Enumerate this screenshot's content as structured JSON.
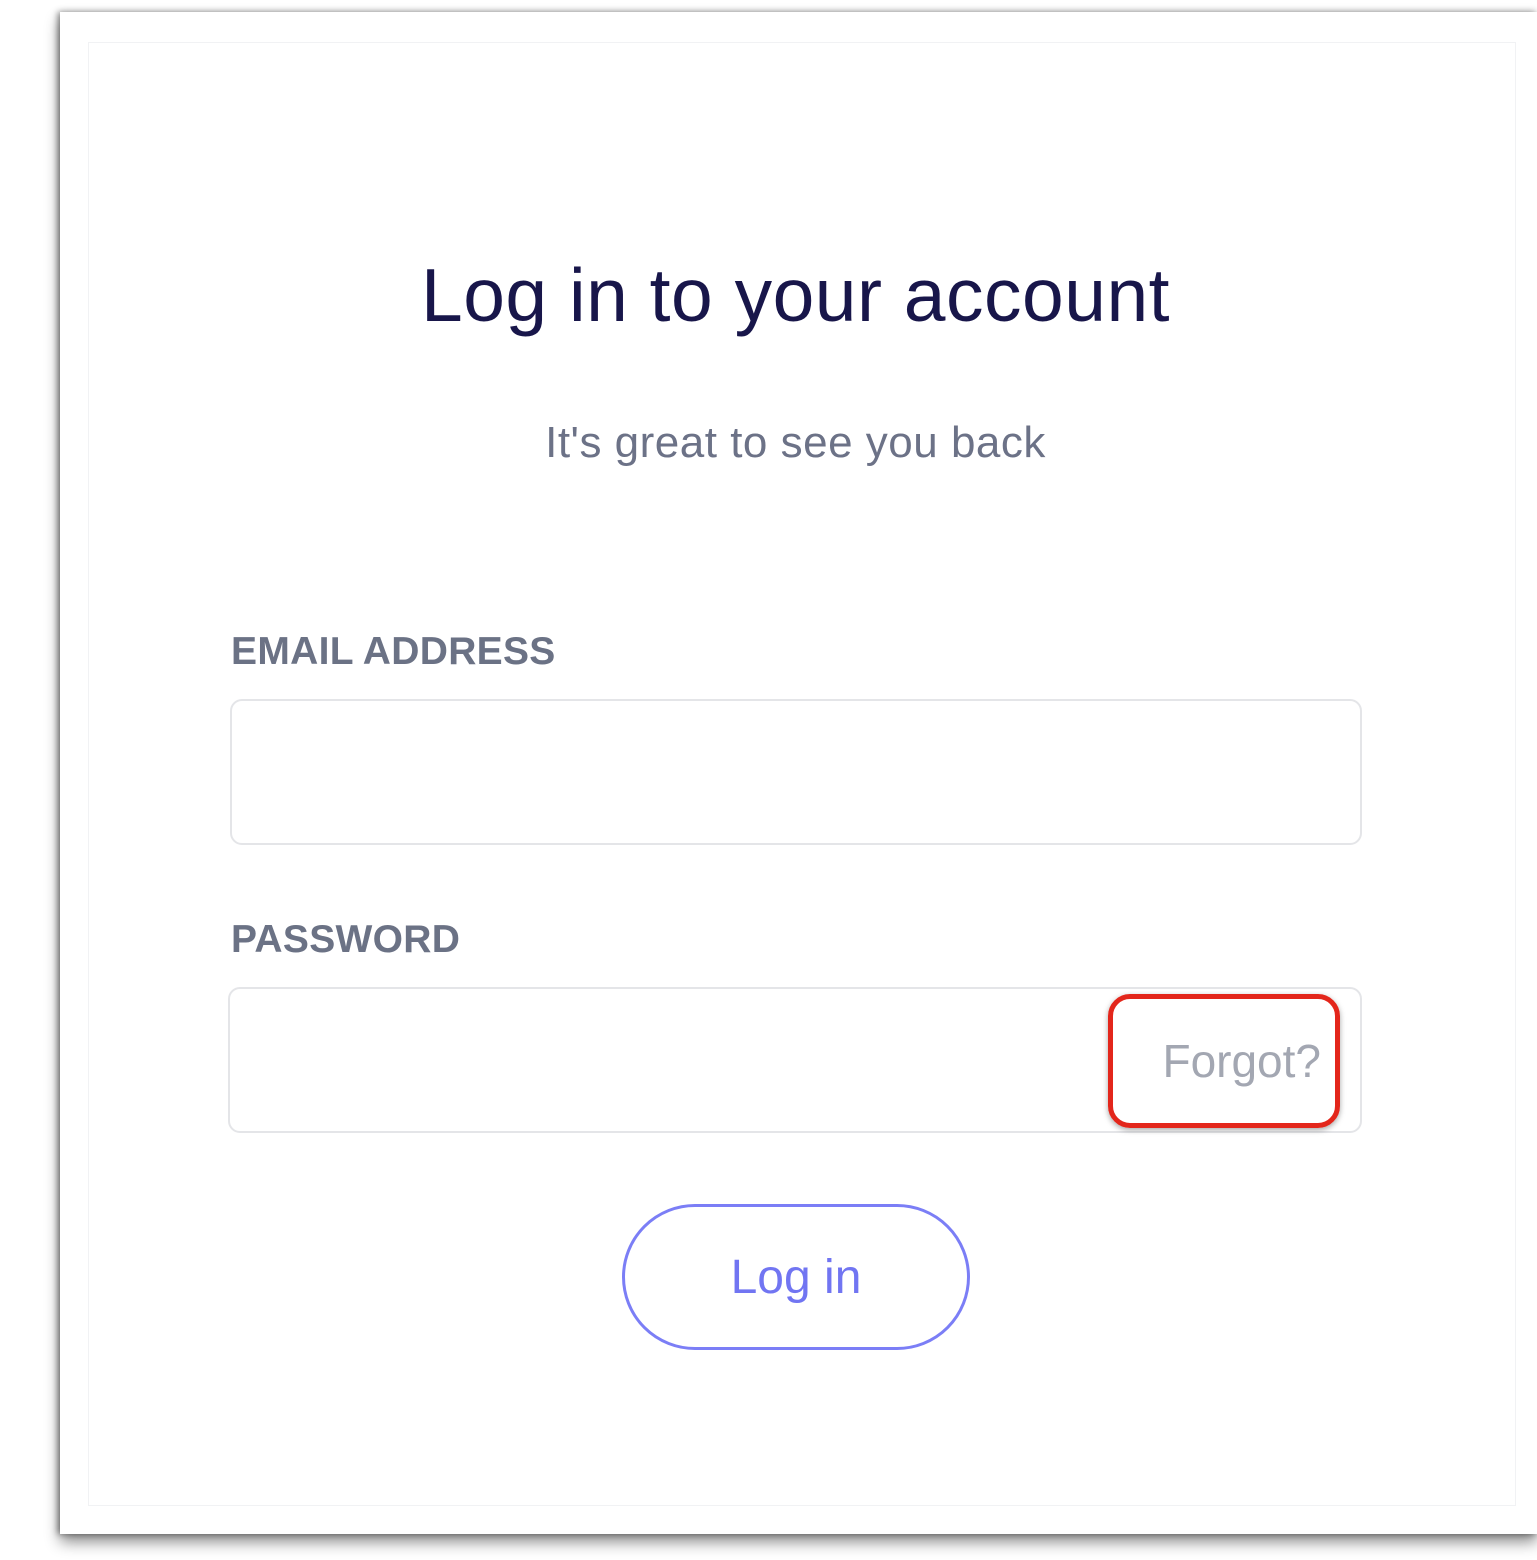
{
  "login": {
    "title": "Log in to your account",
    "subtitle": "It's great to see you back",
    "email": {
      "label": "EMAIL ADDRESS",
      "value": "",
      "placeholder": ""
    },
    "password": {
      "label": "PASSWORD",
      "value": "",
      "placeholder": "",
      "forgot_label": "Forgot?"
    },
    "submit_label": "Log in"
  },
  "colors": {
    "title": "#18164a",
    "muted_text": "#6c7287",
    "accent": "#7175f2",
    "highlight_box": "#e3261b"
  }
}
